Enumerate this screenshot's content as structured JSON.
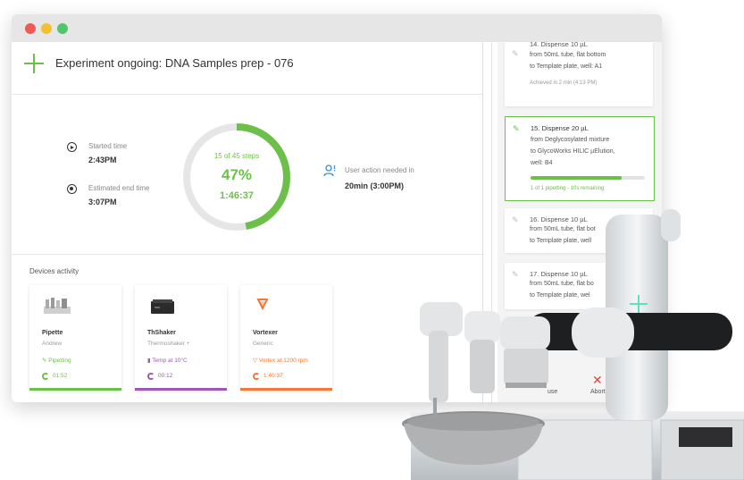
{
  "header": {
    "title": "Experiment ongoing: DNA Samples prep - 076"
  },
  "times": {
    "started_label": "Started time",
    "started_value": "2:43PM",
    "estimated_label": "Estimated end time",
    "estimated_value": "3:07PM"
  },
  "progress_ring": {
    "steps_text": "15 of 45 steps",
    "percent_text": "47%",
    "percent": 0.47,
    "elapsed": "1:46:37",
    "color": "#6cc04a"
  },
  "user_action": {
    "label": "User action needed in",
    "value": "20min (3:00PM)"
  },
  "devices": {
    "title": "Devices activity",
    "items": [
      {
        "name": "Pipette",
        "sub": "Andrew",
        "status": "Pipetting",
        "timer": "01:52",
        "color": "#6cc04a",
        "icon": "pipette-rack-icon"
      },
      {
        "name": "ThShaker",
        "sub": "Thermoshaker +",
        "status": "Temp at 10°C",
        "timer": "00:12",
        "color": "#9b59b6",
        "icon": "thermoshaker-icon"
      },
      {
        "name": "Vortexer",
        "sub": "Generic",
        "status": "Vortex at 1200 rpm",
        "timer": "1:40:37",
        "color": "#f07a3a",
        "icon": "vortex-icon"
      }
    ]
  },
  "steps": [
    {
      "title": "14. Dispense 10 µL",
      "lines": [
        "from 50mL tube, flat bottom",
        "to Template plate, well: A1"
      ],
      "meta": "Achieved in 2 min (4:13 PM)",
      "active": false
    },
    {
      "title": "15. Dispense 20 µL",
      "lines": [
        "from Deglycosylated mixture",
        "to GlycoWorks HILIC µElution,",
        "well: B4"
      ],
      "meta": "1 of 1 pipetting - 10s remaining",
      "progress": 0.8,
      "active": true
    },
    {
      "title": "16. Dispense 10 µL",
      "lines": [
        "from 50mL tube, flat bot",
        "to Template plate, well"
      ],
      "active": false
    },
    {
      "title": "17. Dispense 10 µL",
      "lines": [
        "from 50mL tube, flat bo",
        "to Template plate, wel"
      ],
      "active": false
    }
  ],
  "actions": {
    "pause": "use",
    "abort": "Abort"
  }
}
